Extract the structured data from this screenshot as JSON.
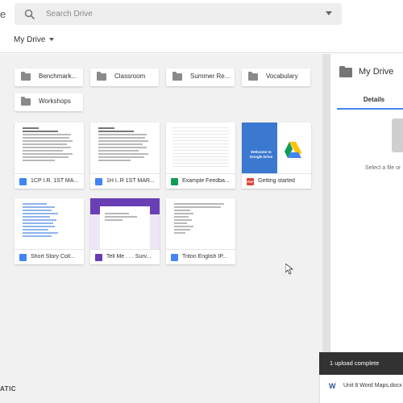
{
  "brand_fragment": "e",
  "search": {
    "placeholder": "Search Drive"
  },
  "breadcrumb": {
    "label": "My Drive"
  },
  "folders": [
    {
      "label": "Benchmark..."
    },
    {
      "label": "Classroom"
    },
    {
      "label": "Summer Re..."
    },
    {
      "label": "Vocabulary"
    },
    {
      "label": "Workshops"
    }
  ],
  "files": [
    {
      "name": "1CP I.R. 1ST MA...",
      "type": "doc",
      "type_color": "#4285f4"
    },
    {
      "name": "1H I..R 1ST MAR...",
      "type": "doc",
      "type_color": "#4285f4"
    },
    {
      "name": "Example Feedba...",
      "type": "sheet",
      "type_color": "#0f9d58"
    },
    {
      "name": "Getting started",
      "type": "pdf",
      "type_color": "#db4437",
      "type_label": "PDF"
    },
    {
      "name": "Short Story Coll...",
      "type": "doc",
      "type_color": "#4285f4"
    },
    {
      "name": "Tell Me . . . Surv...",
      "type": "form",
      "type_color": "#673ab7"
    },
    {
      "name": "Triton English IP...",
      "type": "doc",
      "type_color": "#4285f4"
    }
  ],
  "getting_started_thumb": {
    "title": "Welcome to Google Drive"
  },
  "details_panel": {
    "title": "My Drive",
    "tab": "Details",
    "hint": "Select a file or"
  },
  "upload_toast": {
    "title": "1 upload complete",
    "file_icon": "W",
    "file_name": "Unit 8 Word Maps.docx"
  },
  "watermark": "ATIC",
  "colors": {
    "accent": "#4285f4",
    "toast_bg": "#323232"
  }
}
